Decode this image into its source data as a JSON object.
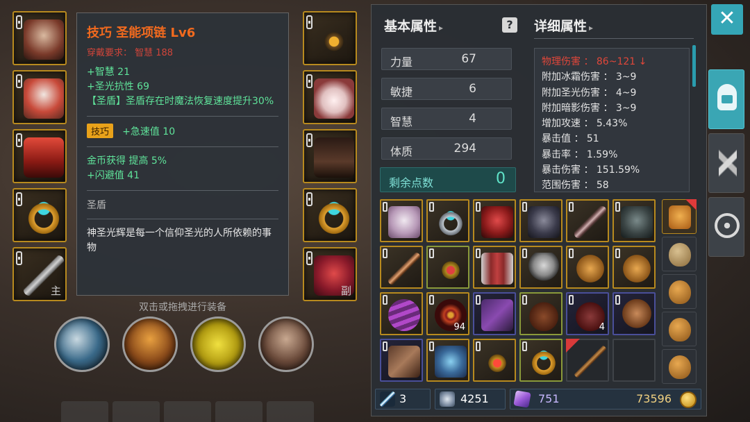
{
  "tooltip": {
    "title": "技巧 圣能项链 Lv6",
    "requirement": "穿戴要求： 智慧 188",
    "stats": [
      "+智慧 21",
      "+圣光抗性 69",
      "【圣盾】圣盾存在时魔法恢复速度提升30%"
    ],
    "badge": "技巧",
    "badge_stat": "+急速值 10",
    "bonus": [
      "金币获得 提高 5%",
      "+闪避值 41"
    ],
    "set_name": "圣盾",
    "description": "神圣光辉是每一个信仰圣光的人所依赖的事物"
  },
  "hint": "双击或拖拽进行装备",
  "equip": {
    "left_weapon_tag": "主",
    "right_weapon_tag": "副"
  },
  "panel": {
    "basic_header": "基本属性",
    "detail_header": "详细属性",
    "attributes": [
      {
        "label": "力量",
        "value": "67"
      },
      {
        "label": "敏捷",
        "value": "6"
      },
      {
        "label": "智慧",
        "value": "4"
      },
      {
        "label": "体质",
        "value": "294"
      }
    ],
    "remaining_label": "剩余点数",
    "remaining_value": "0",
    "details": [
      "物理伤害 ： 86~121 ↓",
      "附加冰霜伤害 ： 3~9",
      "附加圣光伤害 ： 4~9",
      "附加暗影伤害 ： 3~9",
      "增加攻速 ： 5.43%",
      "暴击值 ： 51",
      "暴击率 ： 1.59%",
      "暴击伤害 ： 151.59%",
      "范围伤害 ： 58"
    ]
  },
  "bag": {
    "count_a": "94",
    "count_b": "4"
  },
  "currency": {
    "scrolls": "3",
    "shards": "4251",
    "gems": "751",
    "gold": "73596"
  },
  "icons": {
    "close": "close-icon",
    "help": "question-icon",
    "helmet_tab": "helmet-icon",
    "weapon_tab": "crossed-swords-icon",
    "settings_tab": "compass-icon"
  },
  "colors": {
    "accent": "#35a6b6",
    "item_title": "#f26a1e",
    "requirement": "#d0453a",
    "stat_green": "#5fe39a",
    "gold_border": "#b88a1e"
  }
}
